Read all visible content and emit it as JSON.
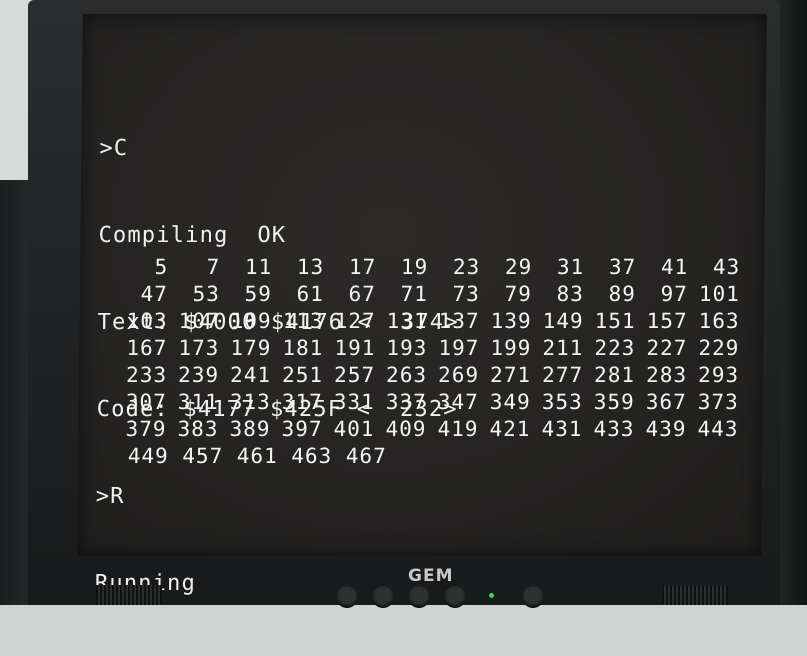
{
  "terminal": {
    "lines": [
      ">C",
      "Compiling  OK",
      "Text: $4000 $4176 <  374>",
      "Code: $4177 $425F <  232>",
      ">R",
      "Running"
    ]
  },
  "primes": [
    [
      "5",
      "7",
      "11",
      "13",
      "17",
      "19",
      "23",
      "29",
      "31",
      "37",
      "41",
      "43"
    ],
    [
      "47",
      "53",
      "59",
      "61",
      "67",
      "71",
      "73",
      "79",
      "83",
      "89",
      "97",
      "101"
    ],
    [
      "103",
      "107",
      "109",
      "113",
      "127",
      "131",
      "137",
      "139",
      "149",
      "151",
      "157",
      "163"
    ],
    [
      "167",
      "173",
      "179",
      "181",
      "191",
      "193",
      "197",
      "199",
      "211",
      "223",
      "227",
      "229"
    ],
    [
      "233",
      "239",
      "241",
      "251",
      "257",
      "263",
      "269",
      "271",
      "277",
      "281",
      "283",
      "293"
    ],
    [
      "307",
      "311",
      "313",
      "317",
      "331",
      "337",
      "347",
      "349",
      "353",
      "359",
      "367",
      "373"
    ],
    [
      "379",
      "383",
      "389",
      "397",
      "401",
      "409",
      "419",
      "421",
      "431",
      "433",
      "439",
      "443"
    ],
    [
      "449",
      "457",
      "461",
      "463",
      "467"
    ]
  ],
  "monitor": {
    "brand": "GEM",
    "led_color": "#3dd35a"
  },
  "colors": {
    "screen_bg": "#252423",
    "text": "#f2f2f0",
    "bezel": "#1f2123"
  }
}
